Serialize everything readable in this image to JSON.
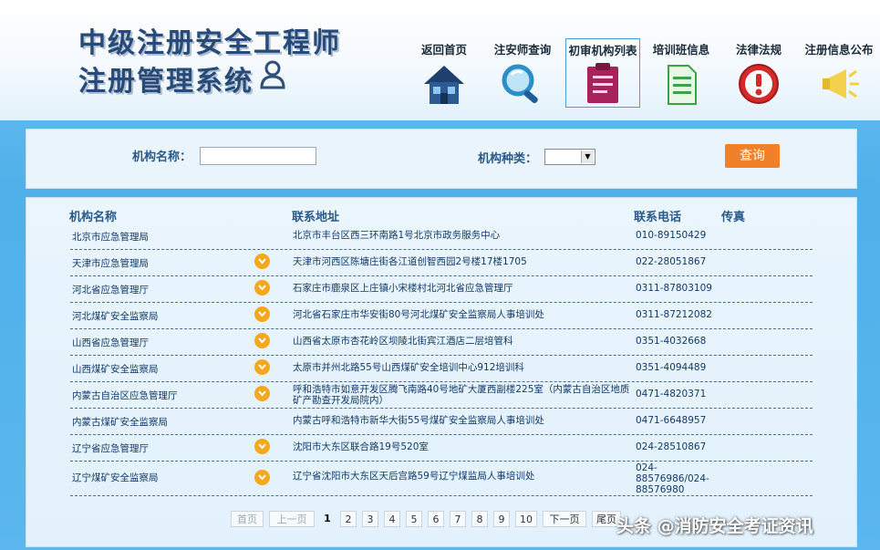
{
  "header": {
    "title_line1": "中级注册安全工程师",
    "title_line2": "注册管理系统",
    "nav": [
      {
        "label": "返回首页",
        "icon": "home-icon"
      },
      {
        "label": "注安师查询",
        "icon": "magnifier-icon"
      },
      {
        "label": "初审机构列表",
        "icon": "clipboard-icon",
        "active": true
      },
      {
        "label": "培训班信息",
        "icon": "document-icon"
      },
      {
        "label": "法律法规",
        "icon": "alert-icon"
      },
      {
        "label": "注册信息公布",
        "icon": "megaphone-icon"
      }
    ]
  },
  "search": {
    "org_name_label": "机构名称：",
    "org_name_value": "",
    "org_type_label": "机构种类：",
    "org_type_value": "",
    "query_label": "查询"
  },
  "table": {
    "columns": [
      "机构名称",
      "联系地址",
      "联系电话",
      "传真"
    ],
    "rows": [
      {
        "name": "北京市应急管理局",
        "address": "北京市丰台区西三环南路1号北京市政务服务中心",
        "phone": "010-89150429",
        "fax": "",
        "expand": false
      },
      {
        "name": "天津市应急管理局",
        "address": "天津市河西区陈塘庄街各江道创智西园2号楼17楼1705",
        "phone": "022-28051867",
        "fax": "",
        "expand": true
      },
      {
        "name": "河北省应急管理厅",
        "address": "石家庄市鹿泉区上庄镇小宋楼村北河北省应急管理厅",
        "phone": "0311-87803109",
        "fax": "",
        "expand": true
      },
      {
        "name": "河北煤矿安全监察局",
        "address": "河北省石家庄市华安街80号河北煤矿安全监察局人事培训处",
        "phone": "0311-87212082",
        "fax": "",
        "expand": true
      },
      {
        "name": "山西省应急管理厅",
        "address": "山西省太原市杏花岭区坝陵北街宾江酒店二层培管科",
        "phone": "0351-4032668",
        "fax": "",
        "expand": true
      },
      {
        "name": "山西煤矿安全监察局",
        "address": "太原市并州北路55号山西煤矿安全培训中心912培训科",
        "phone": "0351-4094489",
        "fax": "",
        "expand": true
      },
      {
        "name": "内蒙古自治区应急管理厅",
        "address": "呼和浩特市如意开发区腾飞南路40号地矿大厦西副楼225室（内蒙古自治区地质矿产勘查开发局院内）",
        "phone": "0471-4820371",
        "fax": "",
        "expand": true
      },
      {
        "name": "内蒙古煤矿安全监察局",
        "address": "内蒙古呼和浩特市新华大街55号煤矿安全监察局人事培训处",
        "phone": "0471-6648957",
        "fax": "",
        "expand": false
      },
      {
        "name": "辽宁省应急管理厅",
        "address": "沈阳市大东区联合路19号520室",
        "phone": "024-28510867",
        "fax": "",
        "expand": true
      },
      {
        "name": "辽宁煤矿安全监察局",
        "address": "辽宁省沈阳市大东区天后宫路59号辽宁煤监局人事培训处",
        "phone": "024-88576986/024-88576980",
        "fax": "",
        "expand": true
      }
    ]
  },
  "pagination": {
    "first": "首页",
    "prev": "上一页",
    "pages": [
      "1",
      "2",
      "3",
      "4",
      "5",
      "6",
      "7",
      "8",
      "9",
      "10"
    ],
    "current": "1",
    "next": "下一页",
    "last": "尾页"
  },
  "watermark": "头条 @消防安全考证资讯",
  "colors": {
    "accent": "#f0812a",
    "header_text": "#274a78",
    "table_text": "#123a6a",
    "expand_icon": "#f4a81d"
  }
}
